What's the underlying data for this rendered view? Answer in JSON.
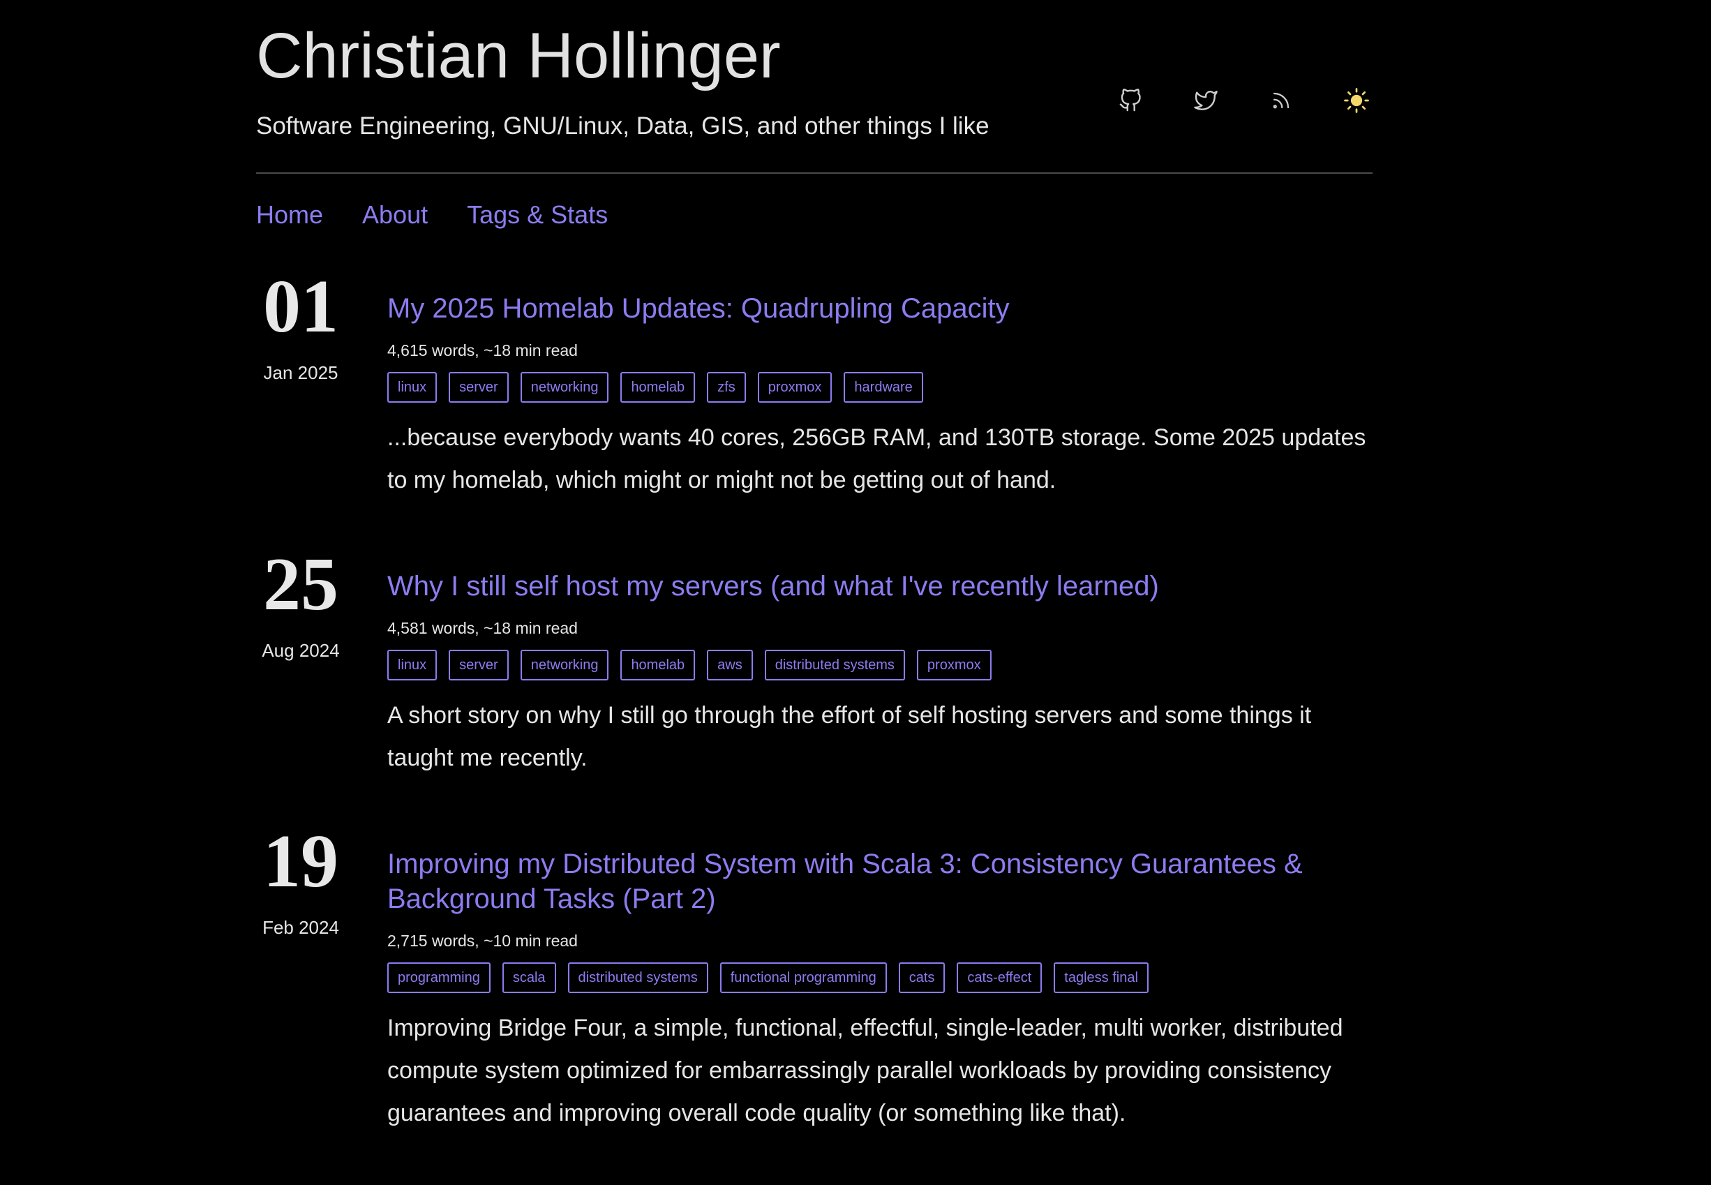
{
  "site": {
    "title": "Christian Hollinger",
    "subtitle": "Software Engineering, GNU/Linux, Data, GIS, and other things I like"
  },
  "header_icons": [
    {
      "name": "github-icon"
    },
    {
      "name": "twitter-icon"
    },
    {
      "name": "rss-icon"
    },
    {
      "name": "sun-icon"
    }
  ],
  "colors": {
    "background": "#000000",
    "accent": "#8c7cf0",
    "text": "#e6e6e6",
    "theme_toggle": "#f5d66b",
    "icon": "#cfcfcf"
  },
  "nav": {
    "items": [
      {
        "label": "Home"
      },
      {
        "label": "About"
      },
      {
        "label": "Tags & Stats"
      }
    ]
  },
  "posts": [
    {
      "day": "01",
      "month_year": "Jan 2025",
      "title": "My 2025 Homelab Updates: Quadrupling Capacity",
      "meta": "4,615 words, ~18 min read",
      "tags": [
        "linux",
        "server",
        "networking",
        "homelab",
        "zfs",
        "proxmox",
        "hardware"
      ],
      "summary": "...because everybody wants 40 cores, 256GB RAM, and 130TB storage. Some 2025 updates to my homelab, which might or might not be getting out of hand."
    },
    {
      "day": "25",
      "month_year": "Aug 2024",
      "title": "Why I still self host my servers (and what I've recently learned)",
      "meta": "4,581 words, ~18 min read",
      "tags": [
        "linux",
        "server",
        "networking",
        "homelab",
        "aws",
        "distributed systems",
        "proxmox"
      ],
      "summary": "A short story on why I still go through the effort of self hosting servers and some things it taught me recently."
    },
    {
      "day": "19",
      "month_year": "Feb 2024",
      "title": "Improving my Distributed System with Scala 3: Consistency Guarantees & Background Tasks (Part 2)",
      "meta": "2,715 words, ~10 min read",
      "tags": [
        "programming",
        "scala",
        "distributed systems",
        "functional programming",
        "cats",
        "cats-effect",
        "tagless final"
      ],
      "summary": "Improving Bridge Four, a simple, functional, effectful, single-leader, multi worker, distributed compute system optimized for embarrassingly parallel workloads by providing consistency guarantees and improving overall code quality (or something like that)."
    }
  ]
}
